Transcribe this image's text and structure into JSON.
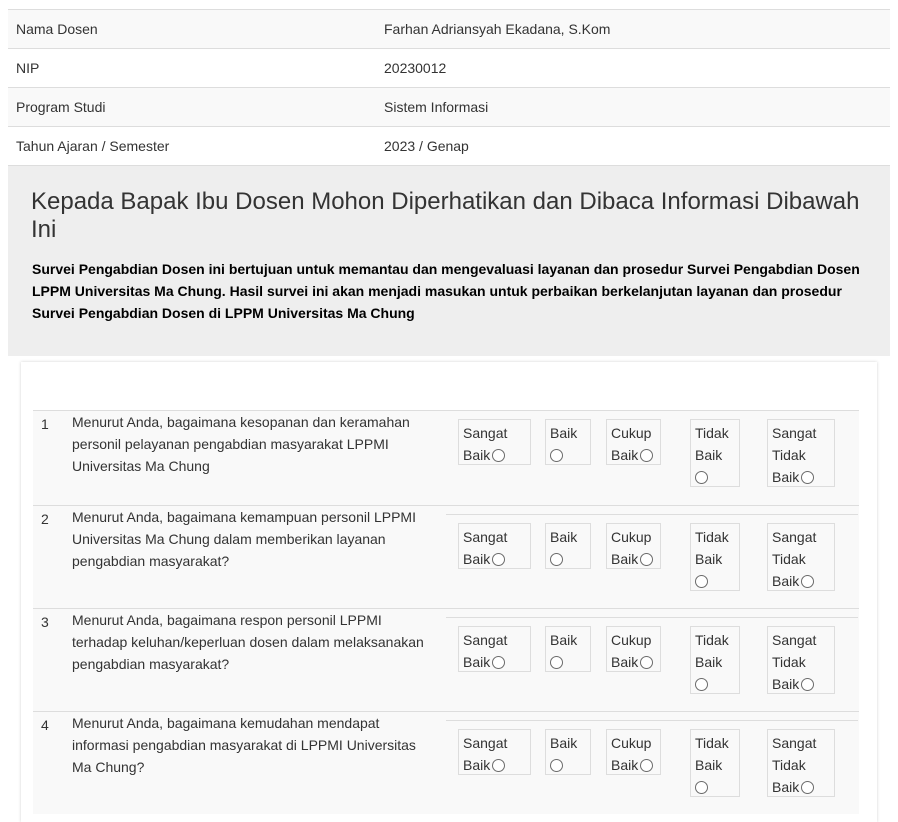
{
  "dosen_info": [
    {
      "label": "Nama Dosen",
      "value": "Farhan Adriansyah Ekadana, S.Kom"
    },
    {
      "label": "NIP",
      "value": "20230012"
    },
    {
      "label": "Program Studi",
      "value": "Sistem Informasi"
    },
    {
      "label": "Tahun Ajaran / Semester",
      "value": "2023 / Genap"
    }
  ],
  "notice": {
    "title": "Kepada Bapak Ibu Dosen Mohon Diperhatikan dan Dibaca Informasi Dibawah Ini",
    "body": "Survei Pengabdian Dosen ini bertujuan untuk memantau dan mengevaluasi layanan dan prosedur Survei Pengabdian Dosen LPPM Universitas Ma Chung. Hasil survei ini akan menjadi masukan untuk perbaikan berkelanjutan layanan dan prosedur Survei Pengabdian Dosen di LPPM Universitas Ma Chung"
  },
  "options": {
    "sangat_baik": [
      "Sangat",
      "Baik"
    ],
    "baik": [
      "Baik"
    ],
    "cukup_baik": [
      "Cukup",
      "Baik"
    ],
    "tidak_baik": [
      "Tidak",
      "Baik"
    ],
    "sangat_tidak_baik": [
      "Sangat",
      "Tidak",
      "Baik"
    ]
  },
  "questions": [
    {
      "number": "1",
      "text": "Menurut Anda, bagaimana kesopanan dan keramahan personil pelayanan pengabdian masyarakat LPPMI Universitas Ma Chung"
    },
    {
      "number": "2",
      "text": "Menurut Anda, bagaimana kemampuan personil LPPMI Universitas Ma Chung dalam memberikan layanan pengabdian masyarakat?"
    },
    {
      "number": "3",
      "text": "Menurut Anda, bagaimana respon personil LPPMI terhadap keluhan/keperluan dosen dalam melaksanakan pengabdian masyarakat?"
    },
    {
      "number": "4",
      "text": "Menurut Anda, bagaimana kemudahan mendapat informasi pengabdian masyarakat di LPPMI Universitas Ma Chung?"
    }
  ]
}
